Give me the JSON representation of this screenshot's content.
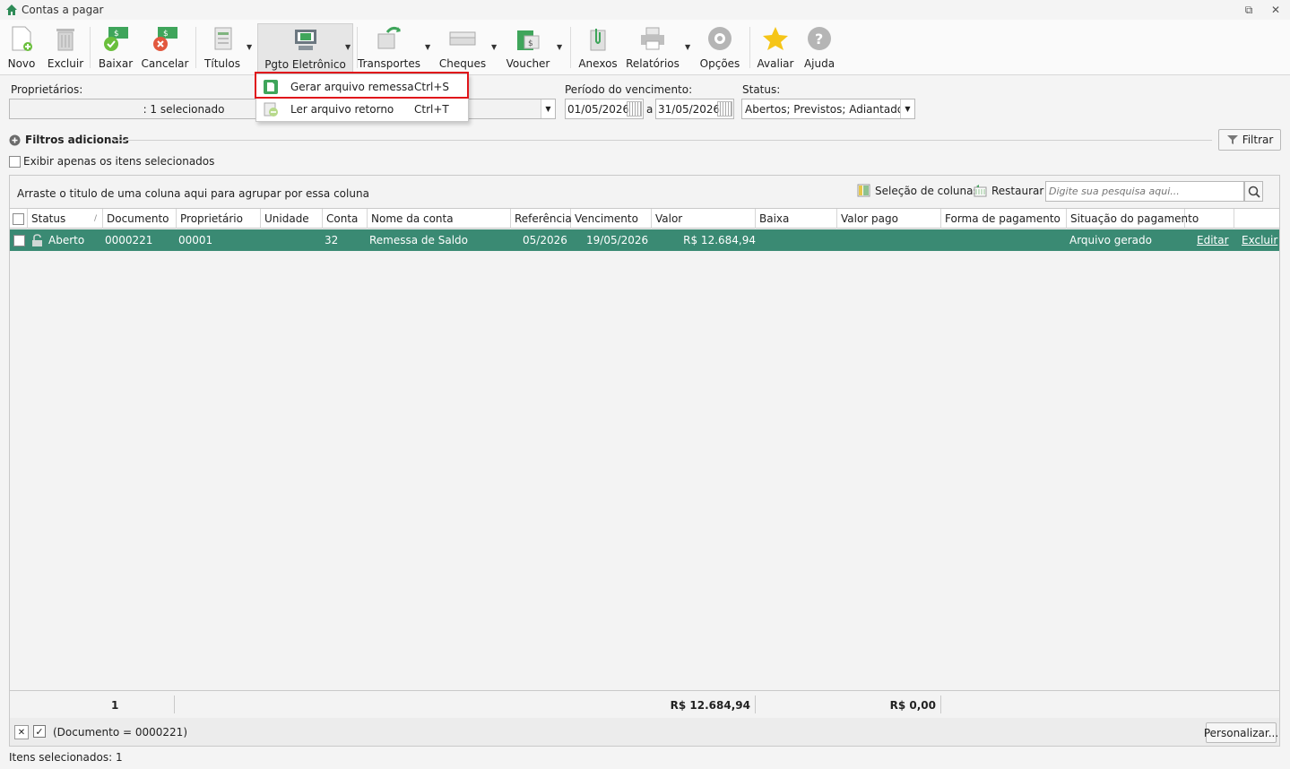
{
  "window": {
    "title": "Contas a pagar"
  },
  "toolbar": {
    "buttons": [
      {
        "label": "Novo"
      },
      {
        "label": "Excluir"
      },
      {
        "label": "Baixar"
      },
      {
        "label": "Cancelar"
      },
      {
        "label": "Títulos"
      },
      {
        "label": "Pgto Eletrônico"
      },
      {
        "label": "Transportes"
      },
      {
        "label": "Cheques"
      },
      {
        "label": "Voucher"
      },
      {
        "label": "Anexos"
      },
      {
        "label": "Relatórios"
      },
      {
        "label": "Opções"
      },
      {
        "label": "Avaliar"
      },
      {
        "label": "Ajuda"
      }
    ]
  },
  "pgto_menu": {
    "items": [
      {
        "label": "Gerar arquivo remessa",
        "shortcut": "Ctrl+S"
      },
      {
        "label": "Ler arquivo retorno",
        "shortcut": "Ctrl+T"
      }
    ]
  },
  "filters": {
    "owners_label": "Proprietários:",
    "owners_value": ": 1 selecionado",
    "period_label": "Período do vencimento:",
    "date_from": "01/05/2026",
    "date_sep": "a",
    "date_to": "31/05/2026",
    "status_label": "Status:",
    "status_value": "Abertos; Previstos; Adiantados",
    "additional_label": "Filtros adicionais",
    "filter_button": "Filtrar",
    "only_selected_label": "Exibir apenas os itens selecionados"
  },
  "grid": {
    "group_hint": "Arraste o titulo de uma coluna aqui para agrupar por essa coluna",
    "column_selection": "Seleção de colunas",
    "restore": "Restaurar",
    "search_placeholder": "Digite sua pesquisa aqui...",
    "columns": [
      "Status",
      "Documento",
      "Proprietário",
      "Unidade",
      "Conta",
      "Nome da conta",
      "Referência",
      "Vencimento",
      "Valor",
      "Baixa",
      "Valor pago",
      "Forma de pagamento",
      "Situação do pagamento"
    ],
    "rows": [
      {
        "status": "Aberto",
        "documento": "0000221",
        "proprietario": "00001",
        "unidade": "",
        "conta": "32",
        "nome_conta": "Remessa de Saldo",
        "referencia": "05/2026",
        "vencimento": "19/05/2026",
        "valor": "R$ 12.684,94",
        "baixa": "",
        "valor_pago": "",
        "forma_pagamento": "",
        "situacao": "Arquivo gerado",
        "edit_label": "Editar",
        "delete_label": "Excluir"
      }
    ],
    "footer": {
      "count": "1",
      "valor_total": "R$ 12.684,94",
      "valor_pago_total": "R$ 0,00"
    }
  },
  "filter_bar": {
    "expression": "(Documento = 0000221)",
    "customize": "Personalizar..."
  },
  "status_bar": {
    "text": "Itens selecionados: 1"
  },
  "colors": {
    "selected_row": "#3a8a73",
    "highlight": "#e0151b",
    "accent_green": "#4caf50"
  }
}
